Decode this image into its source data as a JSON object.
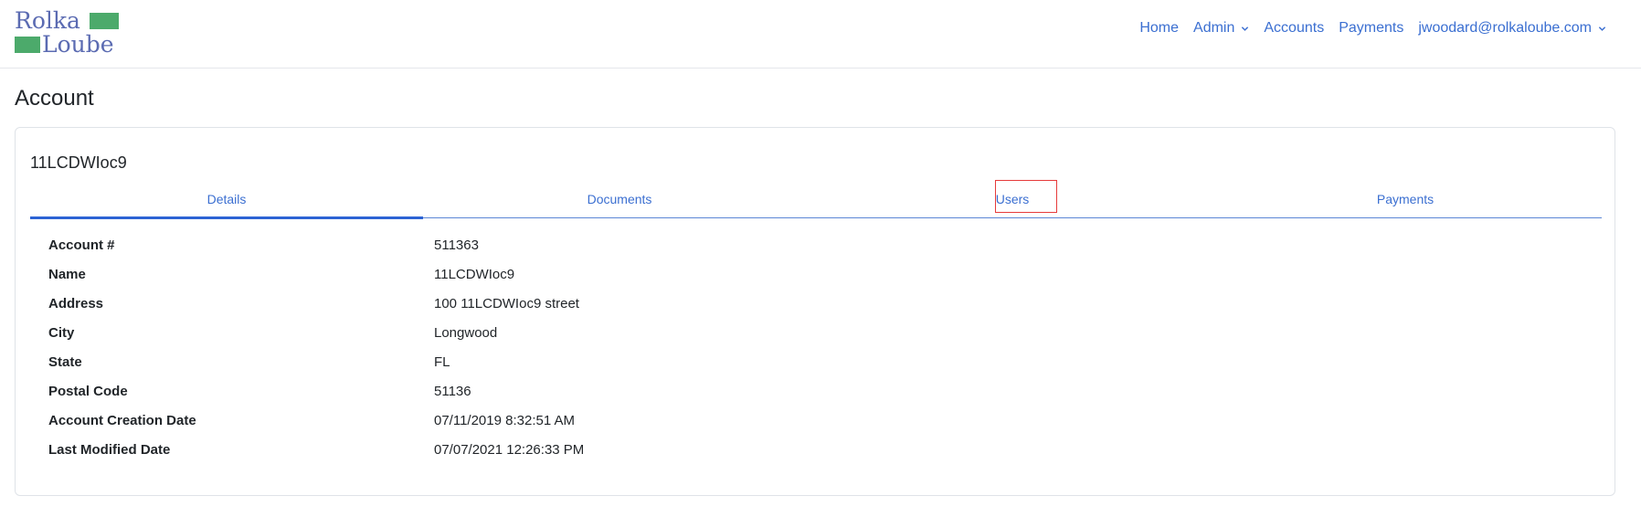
{
  "logo": {
    "line1": "Rolka",
    "line2": "Loube"
  },
  "colors": {
    "accent": "#3b6fd1",
    "logo_text": "#5b6bb2",
    "logo_green": "#4caa6b",
    "highlight": "#e63b3b"
  },
  "nav": {
    "home": "Home",
    "admin": "Admin",
    "accounts": "Accounts",
    "payments": "Payments",
    "user": "jwoodard@rolkaloube.com"
  },
  "page": {
    "title": "Account"
  },
  "account": {
    "heading": "11LCDWIoc9",
    "tabs": [
      "Details",
      "Documents",
      "Users",
      "Payments"
    ],
    "details": [
      {
        "label": "Account #",
        "value": "511363"
      },
      {
        "label": "Name",
        "value": "11LCDWIoc9"
      },
      {
        "label": "Address",
        "value": "100 11LCDWIoc9 street"
      },
      {
        "label": "City",
        "value": "Longwood"
      },
      {
        "label": "State",
        "value": "FL"
      },
      {
        "label": "Postal Code",
        "value": "51136"
      },
      {
        "label": "Account Creation Date",
        "value": "07/11/2019 8:32:51 AM"
      },
      {
        "label": "Last Modified Date",
        "value": "07/07/2021 12:26:33 PM"
      }
    ]
  }
}
